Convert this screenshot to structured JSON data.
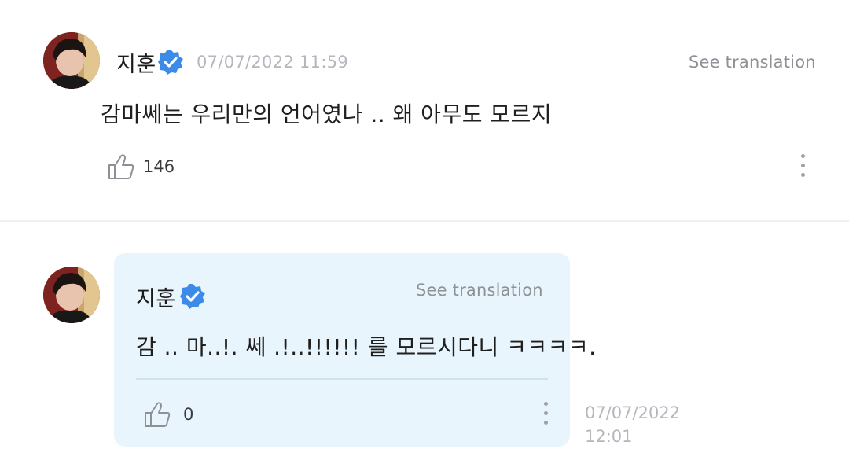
{
  "comment": {
    "author": "지훈",
    "timestamp": "07/07/2022 11:59",
    "see_translation": "See translation",
    "text": "감마쎄는 우리만의 언어였나 .. 왜 아무도 모르지",
    "likes": "146",
    "icons": {
      "verified": "verified-badge-icon",
      "like": "thumbs-up-icon",
      "more": "more-vertical-icon"
    }
  },
  "reply": {
    "author": "지훈",
    "see_translation": "See translation",
    "text": "감 .. 마..!. 쎄 .!..!!!!!! 를 모르시다니 ㅋㅋㅋㅋ.",
    "likes": "0",
    "date": "07/07/2022",
    "time": "12:01"
  },
  "colors": {
    "verified": "#3d8be8",
    "bubble": "#e9f5fc",
    "timestamp": "#b4b7bd",
    "translation_link": "#8e9196"
  }
}
